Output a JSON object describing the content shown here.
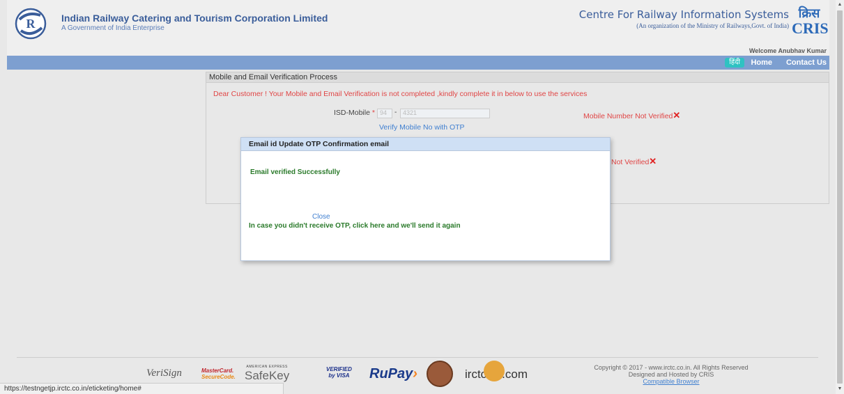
{
  "header": {
    "org_title": "Indian Railway Catering and Tourism Corporation Limited",
    "org_subtitle": "A Government of India Enterprise",
    "cris_title": "Centre For Railway Information Systems",
    "cris_subtitle": "(An organization of the Ministry of Railways,Govt. of India)",
    "cris_logo_hindi": "क्रिस",
    "cris_logo_en": "CRIS",
    "welcome": "Welcome Anubhav Kumar"
  },
  "nav": {
    "hindi": "हिंदी",
    "home": "Home",
    "contact": "Contact Us"
  },
  "panel": {
    "title": "Mobile and Email Verification Process",
    "warning": "Dear Customer ! Your Mobile and Email Verification is not completed ,kindly complete it in below to use the services",
    "isd_label": "ISD-Mobile",
    "required_mark": "*",
    "isd_value": "94",
    "isd_separator": "-",
    "mobile_value": "4321",
    "verify_mobile": "Verify Mobile No with OTP",
    "mobile_status": "Mobile Number Not Verified",
    "email_status": "Not Verified",
    "x_mark": "✕"
  },
  "modal": {
    "title": "Email id Update OTP Confirmation email",
    "message": "Email verified Successfully",
    "close": "Close",
    "resend": "In case you didn't receive OTP, click here and we'll send it again"
  },
  "footer": {
    "verisign": "VeriSign",
    "mastercard_1": "MasterCard.",
    "mastercard_2": "SecureCode.",
    "safekey_top": "AMERICAN EXPRESS",
    "safekey": "SafeKey",
    "vbv_1": "VERIFIED",
    "vbv_2": "by VISA",
    "rupay": "RuPay",
    "irctc_tourism_1": "irctc",
    "irctc_tourism_2": ".com",
    "copyright": "Copyright © 2017 - www.irctc.co.in. All Rights Reserved",
    "designed": "Designed and Hosted by CRIS",
    "compatible": "Compatible Browser"
  },
  "statusbar": {
    "url": "https://testngetjp.irctc.co.in/eticketing/home#"
  },
  "colors": {
    "nav_bg": "#7d9fd0",
    "brand_blue": "#3a5d9a",
    "error_red": "#e04545",
    "success_green": "#2a7a2a",
    "link_blue": "#3f7fd0"
  }
}
